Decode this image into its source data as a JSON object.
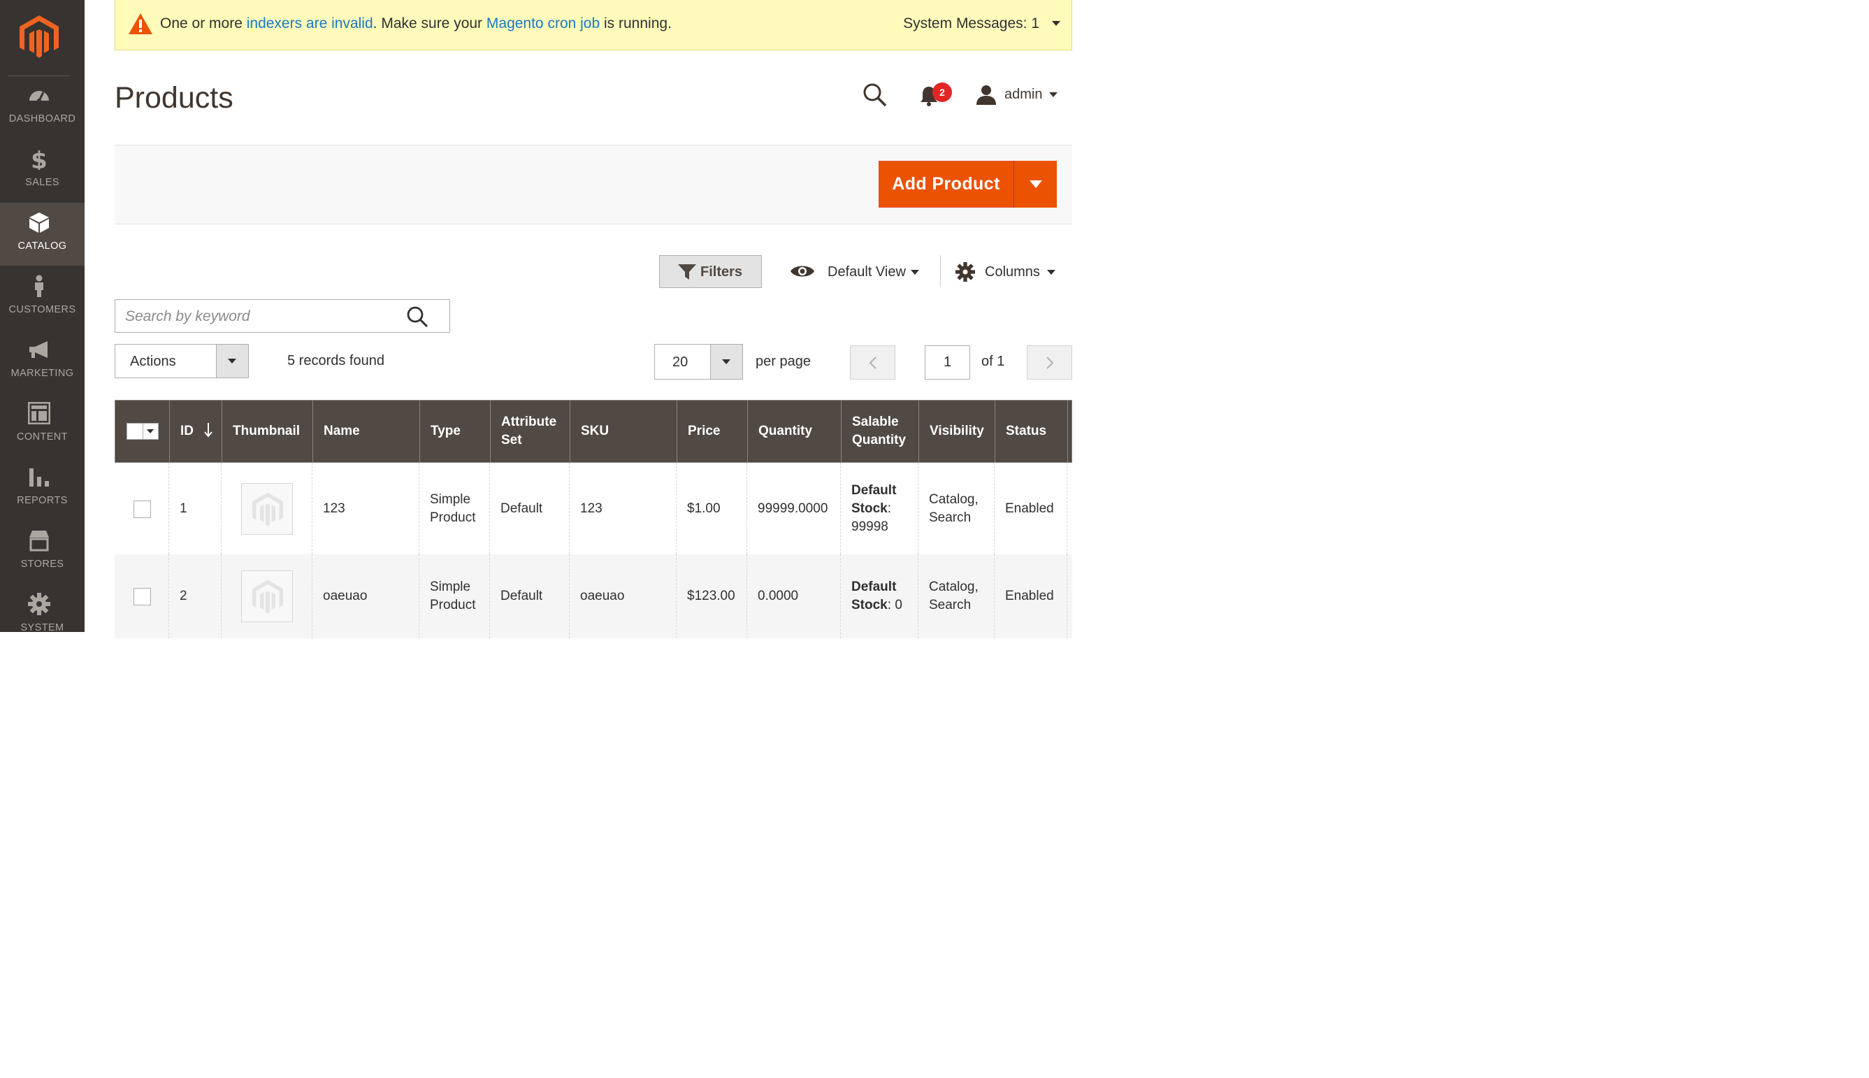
{
  "sidebar": {
    "items": [
      {
        "label": "DASHBOARD",
        "icon": "speedometer-icon"
      },
      {
        "label": "SALES",
        "icon": "dollar-icon"
      },
      {
        "label": "CATALOG",
        "icon": "box-icon",
        "active": true
      },
      {
        "label": "CUSTOMERS",
        "icon": "person-icon"
      },
      {
        "label": "MARKETING",
        "icon": "megaphone-icon"
      },
      {
        "label": "CONTENT",
        "icon": "layout-icon"
      },
      {
        "label": "REPORTS",
        "icon": "bar-chart-icon"
      },
      {
        "label": "STORES",
        "icon": "storefront-icon"
      },
      {
        "label": "SYSTEM",
        "icon": "gear-icon"
      }
    ]
  },
  "system_message": {
    "prefix": "One or more ",
    "link1": "indexers are invalid",
    "middle": ". Make sure your ",
    "link2": "Magento cron job",
    "suffix": " is running.",
    "counter": "System Messages: 1"
  },
  "header": {
    "title": "Products",
    "notification_count": "2",
    "user": "admin"
  },
  "toolbar": {
    "add_label": "Add Product"
  },
  "grid_controls": {
    "filters_label": "Filters",
    "view_label": "Default View",
    "columns_label": "Columns",
    "search_placeholder": "Search by keyword",
    "actions_label": "Actions",
    "records_text": "5 records found",
    "per_page_value": "20",
    "per_page_label": "per page",
    "current_page": "1",
    "page_total": "of 1"
  },
  "table": {
    "headers": {
      "id": "ID",
      "thumbnail": "Thumbnail",
      "name": "Name",
      "type": "Type",
      "attribute_set_1": "Attribute",
      "attribute_set_2": "Set",
      "sku": "SKU",
      "price": "Price",
      "quantity": "Quantity",
      "salable_1": "Salable",
      "salable_2": "Quantity",
      "visibility": "Visibility",
      "status": "Status"
    },
    "rows": [
      {
        "id": "1",
        "name": "123",
        "type_1": "Simple",
        "type_2": "Product",
        "attribute_set": "Default",
        "sku": "123",
        "price": "$1.00",
        "quantity": "99999.0000",
        "salable_label_1": "Default",
        "salable_label_2": "Stock",
        "salable_value": "99998",
        "visibility_1": "Catalog,",
        "visibility_2": "Search",
        "status": "Enabled"
      },
      {
        "id": "2",
        "name": "oaeuao",
        "type_1": "Simple",
        "type_2": "Product",
        "attribute_set": "Default",
        "sku": "oaeuao",
        "price": "$123.00",
        "quantity": "0.0000",
        "salable_label_1": "Default",
        "salable_label_2": "Stock",
        "salable_value": "0",
        "visibility_1": "Catalog,",
        "visibility_2": "Search",
        "status": "Enabled"
      }
    ]
  },
  "colors": {
    "sidebar_bg": "#373330",
    "sidebar_active": "#514943",
    "accent_orange": "#eb5202",
    "header_bg": "#514943",
    "message_bg": "#fffbbb",
    "link_blue": "#1979c3",
    "badge_red": "#e22626"
  }
}
